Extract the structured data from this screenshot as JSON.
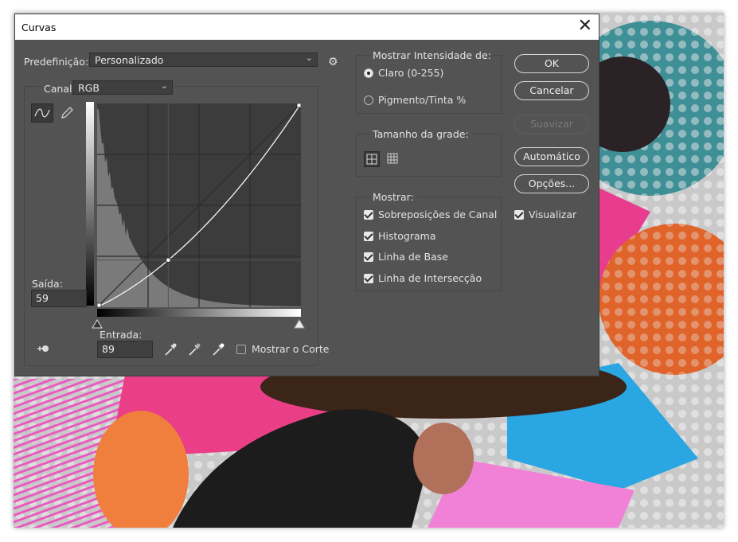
{
  "dialog": {
    "title": "Curvas",
    "preset_label": "Predefinição:",
    "preset_value": "Personalizado",
    "channel_label": "Canal:",
    "channel_value": "RGB",
    "output_label": "Saída:",
    "output_value": "59",
    "input_label": "Entrada:",
    "input_value": "89",
    "show_clipping_label": "Mostrar o Corte"
  },
  "intensity": {
    "title": "Mostrar Intensidade de:",
    "option_light": "Claro (0-255)",
    "option_pigment": "Pigmento/Tinta %"
  },
  "grid": {
    "title": "Tamanho da grade:"
  },
  "show": {
    "title": "Mostrar:",
    "channel_overlays": "Sobreposições de Canal",
    "histogram": "Histograma",
    "baseline": "Linha de Base",
    "intersection_line": "Linha de Intersecção"
  },
  "buttons": {
    "ok": "OK",
    "cancel": "Cancelar",
    "smooth": "Suavizar",
    "auto": "Automático",
    "options": "Opções...",
    "preview": "Visualizar"
  },
  "curve": {
    "control_point": {
      "input": 89,
      "output": 59
    },
    "range": [
      0,
      255
    ]
  },
  "colors": {
    "dialog_bg": "#535353",
    "graph_bg": "#3c3c3c",
    "histogram": "#7a7a7a"
  }
}
